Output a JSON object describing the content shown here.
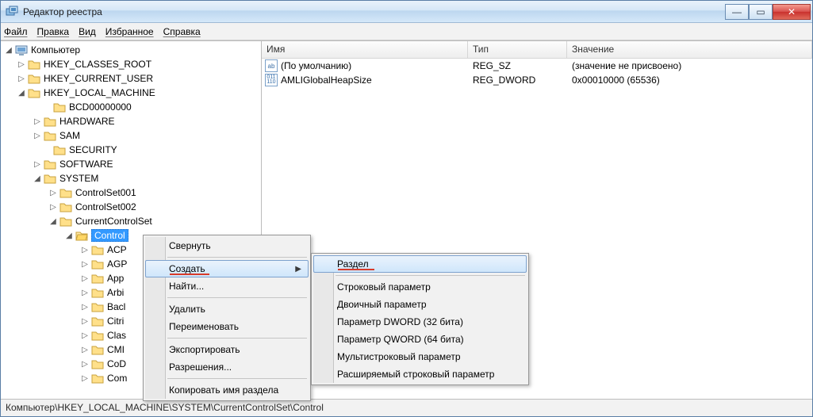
{
  "window": {
    "title": "Редактор реестра"
  },
  "menu": {
    "file": "Файл",
    "edit": "Правка",
    "view": "Вид",
    "fav": "Избранное",
    "help": "Справка"
  },
  "tree": {
    "root": "Компьютер",
    "hkcr": "HKEY_CLASSES_ROOT",
    "hkcu": "HKEY_CURRENT_USER",
    "hklm": "HKEY_LOCAL_MACHINE",
    "bcd": "BCD00000000",
    "hardware": "HARDWARE",
    "sam": "SAM",
    "security": "SECURITY",
    "software": "SOFTWARE",
    "system": "SYSTEM",
    "cs001": "ControlSet001",
    "cs002": "ControlSet002",
    "ccs": "CurrentControlSet",
    "control": "Control",
    "acp": "ACP",
    "agp": "AGP",
    "app": "App",
    "arbi": "Arbi",
    "bacl": "Bacl",
    "citri": "Citri",
    "clas": "Clas",
    "cmi": "CMI",
    "cod": "CoD",
    "com": "Com"
  },
  "list": {
    "hdr_name": "Имя",
    "hdr_type": "Тип",
    "hdr_val": "Значение",
    "rows": [
      {
        "name": "(По умолчанию)",
        "type": "REG_SZ",
        "val": "(значение не присвоено)",
        "kind": "sz"
      },
      {
        "name": "AMLIGlobalHeapSize",
        "type": "REG_DWORD",
        "val": "0x00010000 (65536)",
        "kind": "bin"
      }
    ]
  },
  "ctx1": {
    "collapse": "Свернуть",
    "create": "Создать",
    "find": "Найти...",
    "delete": "Удалить",
    "rename": "Переименовать",
    "export": "Экспортировать",
    "perms": "Разрешения...",
    "copyname": "Копировать имя раздела"
  },
  "ctx2": {
    "key": "Раздел",
    "string": "Строковый параметр",
    "binary": "Двоичный параметр",
    "dword": "Параметр DWORD (32 бита)",
    "qword": "Параметр QWORD (64 бита)",
    "multi": "Мультистроковый параметр",
    "expand": "Расширяемый строковый параметр"
  },
  "status": "Компьютер\\HKEY_LOCAL_MACHINE\\SYSTEM\\CurrentControlSet\\Control"
}
